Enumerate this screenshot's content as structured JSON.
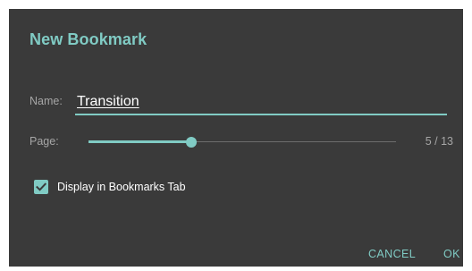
{
  "dialog": {
    "title": "New Bookmark",
    "name_label": "Name:",
    "name_value": "Transition",
    "page_label": "Page:",
    "page_current": 5,
    "page_total": 13,
    "page_display": "5 / 13",
    "checkbox_label": "Display in Bookmarks Tab",
    "checkbox_checked": true,
    "cancel_label": "CANCEL",
    "ok_label": "OK"
  },
  "colors": {
    "accent": "#80cbc4",
    "dialog_background": "#3a3a3a",
    "secondary_text": "#a6a6a6",
    "primary_text": "#ffffff"
  },
  "icons": {
    "checkbox": "check-icon"
  }
}
